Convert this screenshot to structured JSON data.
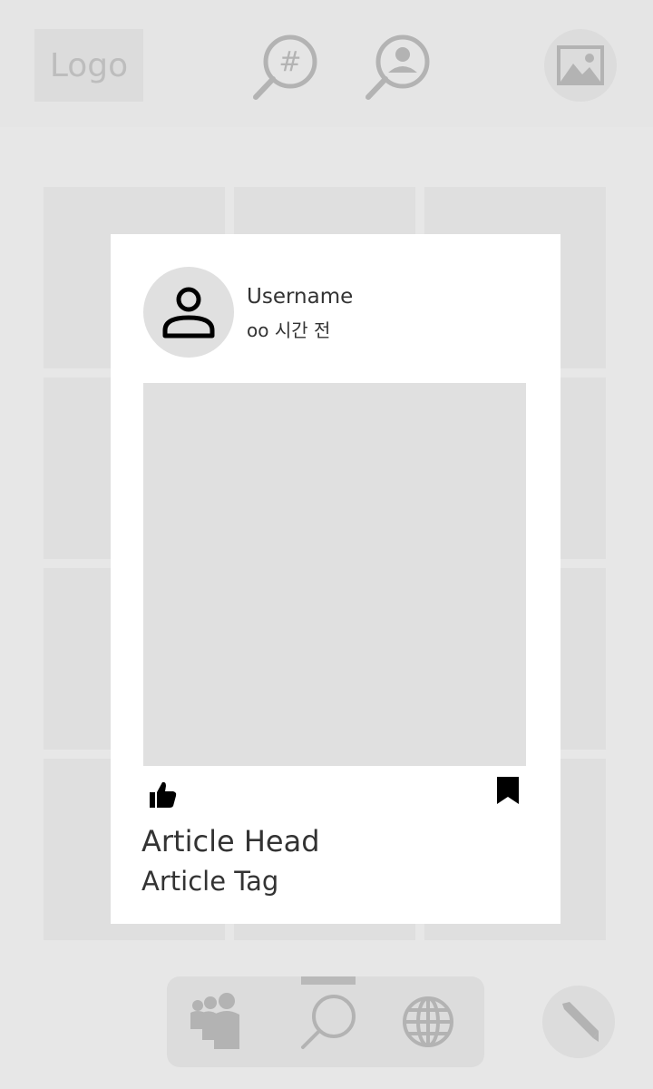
{
  "header": {
    "logo_text": "Logo",
    "icons": [
      "hashtag-search-icon",
      "user-search-icon",
      "gallery-icon"
    ]
  },
  "grid": {
    "tile_count": 12
  },
  "post": {
    "username": "Username",
    "time_ago": "oo 시간 전",
    "article_head": "Article Head",
    "article_tag": "Article Tag",
    "icons": [
      "like-icon",
      "bookmark-icon"
    ]
  },
  "bottom_nav": {
    "items": [
      "community-icon",
      "search-icon",
      "globe-icon"
    ],
    "active_item": "search-icon",
    "write_button_icon": "pencil-icon"
  },
  "colors": {
    "background": "#e7e7e7",
    "icon_gray": "#b3b3b3",
    "card": "#ffffff",
    "text": "#333333"
  }
}
